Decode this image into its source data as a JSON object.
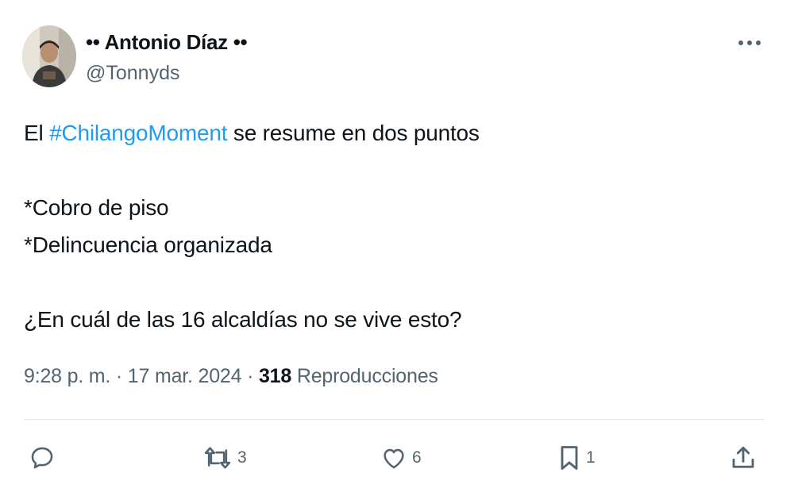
{
  "author": {
    "display_name": "•• Antonio Díaz ••",
    "handle": "@Tonnyds"
  },
  "tweet": {
    "lines": [
      {
        "before": "El ",
        "hashtag": "#ChilangoMoment",
        "after": " se resume en dos puntos"
      },
      {
        "text": ""
      },
      {
        "text": "*Cobro de piso"
      },
      {
        "text": "*Delincuencia organizada"
      },
      {
        "text": ""
      },
      {
        "text": "¿En cuál de las 16 alcaldías no se vive esto?"
      }
    ]
  },
  "meta": {
    "time": "9:28 p. m.",
    "separator1": " · ",
    "date": "17 mar. 2024",
    "separator2": " · ",
    "views_count": "318",
    "views_label": " Reproducciones"
  },
  "actions": {
    "reply": {
      "icon": "reply-icon",
      "count": ""
    },
    "retweet": {
      "icon": "retweet-icon",
      "count": "3"
    },
    "like": {
      "icon": "heart-icon",
      "count": "6"
    },
    "bookmark": {
      "icon": "bookmark-icon",
      "count": "1"
    },
    "share": {
      "icon": "share-icon"
    }
  },
  "more_icon": "more-horizontal-icon",
  "colors": {
    "text": "#0f1419",
    "secondary": "#536471",
    "link": "#1d9bf0",
    "divider": "#e6e9ec"
  }
}
